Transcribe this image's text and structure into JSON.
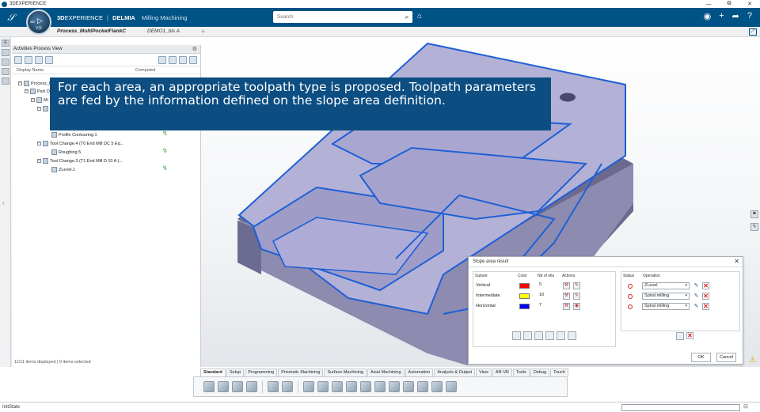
{
  "os": {
    "title": "3DEXPERIENCE",
    "min": "—",
    "restore": "⧉",
    "close": "✕"
  },
  "header": {
    "brand_3d": "3D",
    "brand_exp": "EXPERIENCE",
    "brand_sep": "|",
    "brand_delmia": "DELMIA",
    "app": "Milling Machining",
    "search_placeholder": "Search"
  },
  "compass": {
    "label_3d": "3D",
    "version": "V,R"
  },
  "tabs": [
    {
      "label": "Process_MultiPocketFlankC"
    },
    {
      "label": "DEMO1_bis A"
    }
  ],
  "tree": {
    "panel_title": "Activities Process View",
    "col_display": "Display Name",
    "col_computed": "Computed",
    "rows": [
      {
        "label": "Process_M"
      },
      {
        "label": "Part Op"
      },
      {
        "label": "Mi"
      },
      {
        "label": ""
      },
      {
        "label": "Profile Contouring.1"
      },
      {
        "label": "Tool Change.4 (T0 End Mill DC 5 Eq..."
      },
      {
        "label": "Roughing.5"
      },
      {
        "label": "Tool Change.3 (T1 End Mill D 10 A (..."
      },
      {
        "label": "ZLevel.1"
      }
    ],
    "status": "11/11 items displayed | 0 items selected"
  },
  "caption": {
    "text": "For each area, an appropriate toolpath type is proposed. Toolpath parameters are fed by the information defined on the slope area definition."
  },
  "dialog": {
    "title": "Slope area result",
    "headers": {
      "subset": "Subset",
      "color": "Color",
      "nb": "Nb of elts",
      "actions": "Actions",
      "status": "Status",
      "operation": "Operation"
    },
    "rows": [
      {
        "subset": "Vertical",
        "color": "#ff0000",
        "nb": "5",
        "operation": "ZLevel"
      },
      {
        "subset": "Intermediate",
        "color": "#ffff00",
        "nb": "10",
        "operation": "Spiral milling"
      },
      {
        "subset": "Horizontal",
        "color": "#0000ff",
        "nb": "7",
        "operation": "Spiral milling"
      }
    ],
    "ok": "OK",
    "cancel": "Cancel"
  },
  "bottom_tabs": [
    {
      "label": "Standard",
      "active": true
    },
    {
      "label": "Setup"
    },
    {
      "label": "Programming"
    },
    {
      "label": "Prismatic Machining"
    },
    {
      "label": "Surface Machining"
    },
    {
      "label": "Axial Machining"
    },
    {
      "label": "Automation"
    },
    {
      "label": "Analysis & Output"
    },
    {
      "label": "View"
    },
    {
      "label": "AR-VR"
    },
    {
      "label": "Tools"
    },
    {
      "label": "Debug"
    },
    {
      "label": "Touch"
    }
  ],
  "status_bar": {
    "text": "InitState"
  },
  "colors": {
    "brand": "#005386",
    "caption_bg": "#0c4e82",
    "part_edge": "#1f5fd6",
    "part_face": "#a9a7cf"
  }
}
